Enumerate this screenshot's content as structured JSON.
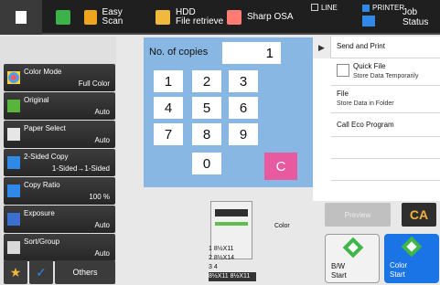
{
  "topbar": {
    "easy_scan": "Easy Scan",
    "hdd": "HDD",
    "file_retrieve": "File retrieve",
    "osa": "Sharp OSA",
    "line": "LINE",
    "printer": "PRINTER",
    "job_status": "Job Status"
  },
  "left_menu": [
    {
      "name": "Color Mode",
      "value": "Full Color"
    },
    {
      "name": "Original",
      "value": "Auto"
    },
    {
      "name": "Paper Select",
      "value": "Auto"
    },
    {
      "name": "2-Sided Copy",
      "value": "1-Sided→1-Sided"
    },
    {
      "name": "Copy Ratio",
      "value": "100 %"
    },
    {
      "name": "Exposure",
      "value": "Auto"
    },
    {
      "name": "Sort/Group",
      "value": "Auto"
    }
  ],
  "bottom_left": {
    "others": "Others"
  },
  "copies": {
    "label": "No. of copies",
    "value": "1",
    "keys": [
      "1",
      "2",
      "3",
      "4",
      "5",
      "6",
      "7",
      "8",
      "9",
      "0"
    ],
    "clear": "C"
  },
  "right_panel": {
    "send_and_print": "Send and Print",
    "quick_file": "Quick File",
    "quick_file_sub": "Store Data Temporarily",
    "file": "File",
    "file_sub": "Store Data in Folder",
    "eco": "Call Eco Program"
  },
  "preview_area": {
    "paper_rows": [
      "1 8½X11",
      "2 8½X14",
      "3 4",
      "8½X11 8½X11"
    ],
    "color_label": "Color"
  },
  "controls": {
    "preview": "Preview",
    "ca": "CA",
    "bw_label": "B/W",
    "bw_start": "Start",
    "color_label": "Color",
    "color_start": "Start"
  }
}
